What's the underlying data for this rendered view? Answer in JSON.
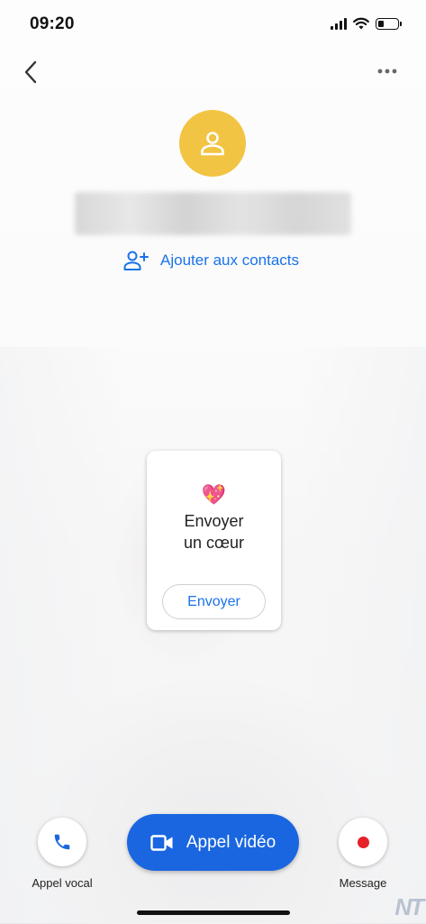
{
  "status_bar": {
    "time": "09:20"
  },
  "contact": {
    "add_contact_label": "Ajouter aux contacts"
  },
  "card": {
    "emoji": "💖",
    "title_line1": "Envoyer",
    "title_line2": "un cœur",
    "send_label": "Envoyer"
  },
  "actions": {
    "voice_label": "Appel vocal",
    "video_label": "Appel vidéo",
    "message_label": "Message"
  },
  "watermark": "NT",
  "colors": {
    "accent": "#1a73e8",
    "avatar": "#f2c443",
    "video_button": "#1a66e0",
    "record_dot": "#e5202a"
  }
}
